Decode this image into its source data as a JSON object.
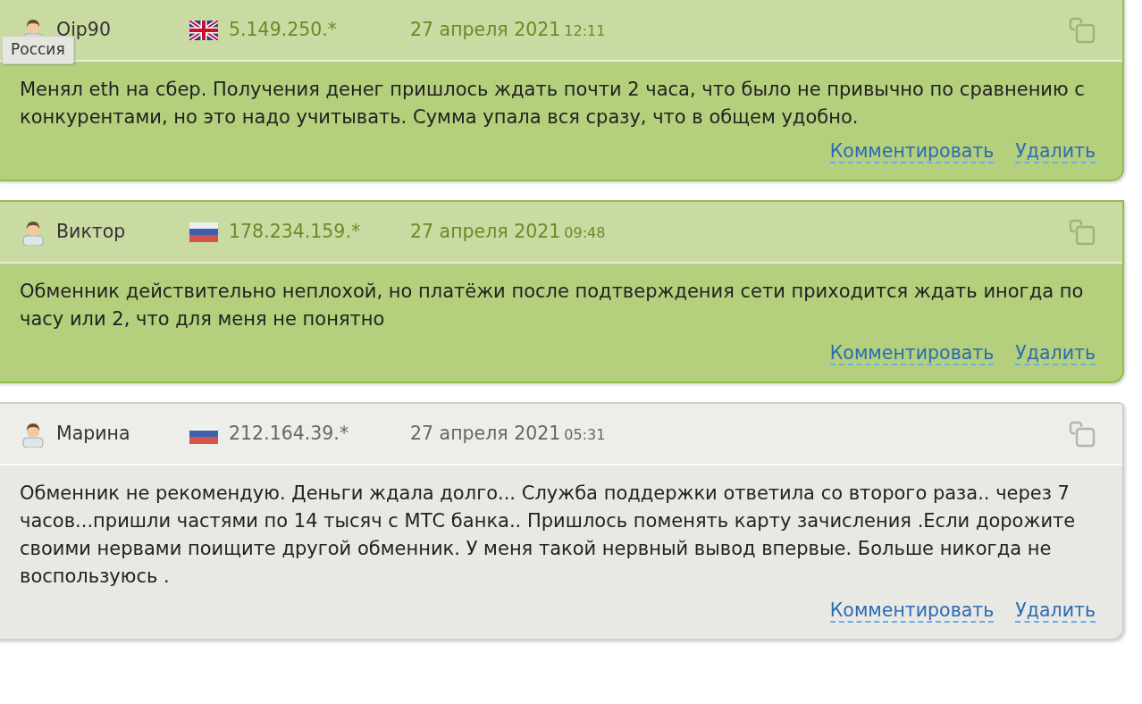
{
  "tooltip": {
    "text": "Россия"
  },
  "reviews": [
    {
      "kind": "positive",
      "author": "Oip90",
      "flag": {
        "kind": "gb"
      },
      "ip": "5.149.250.*",
      "date": "27 апреля 2021",
      "time": "12:11",
      "text": "Менял eth на сбер. Получения денег пришлось ждать почти 2 часа, что было не привычно по сравнению с конкурентами, но это надо учитывать. Сумма упала вся сразу, что в общем удобно.",
      "actions": [
        "Комментировать",
        "Удалить"
      ]
    },
    {
      "kind": "positive",
      "author": "Виктор",
      "flag": {
        "kind": "ru"
      },
      "ip": "178.234.159.*",
      "date": "27 апреля 2021",
      "time": "09:48",
      "text": "Обменник действительно неплохой, но платёжи после подтверждения сети приходится ждать иногда по часу или 2, что для меня не понятно",
      "actions": [
        "Комментировать",
        "Удалить"
      ]
    },
    {
      "kind": "neutral",
      "author": "Марина",
      "flag": {
        "kind": "ru"
      },
      "ip": "212.164.39.*",
      "date": "27 апреля 2021",
      "time": "05:31",
      "text": "Обменник не рекомендую. Деньги ждала долго... Служба поддержки ответила со второго раза.. через 7 часов...пришли частями по 14 тысяч с МТС банка.. Пришлось поменять карту зачисления .Если дорожите своими нервами поищите другой обменник. У меня такой нервный вывод впервые. Больше никогда не воспользуюсь .",
      "actions": [
        "Комментировать",
        "Удалить"
      ]
    }
  ]
}
